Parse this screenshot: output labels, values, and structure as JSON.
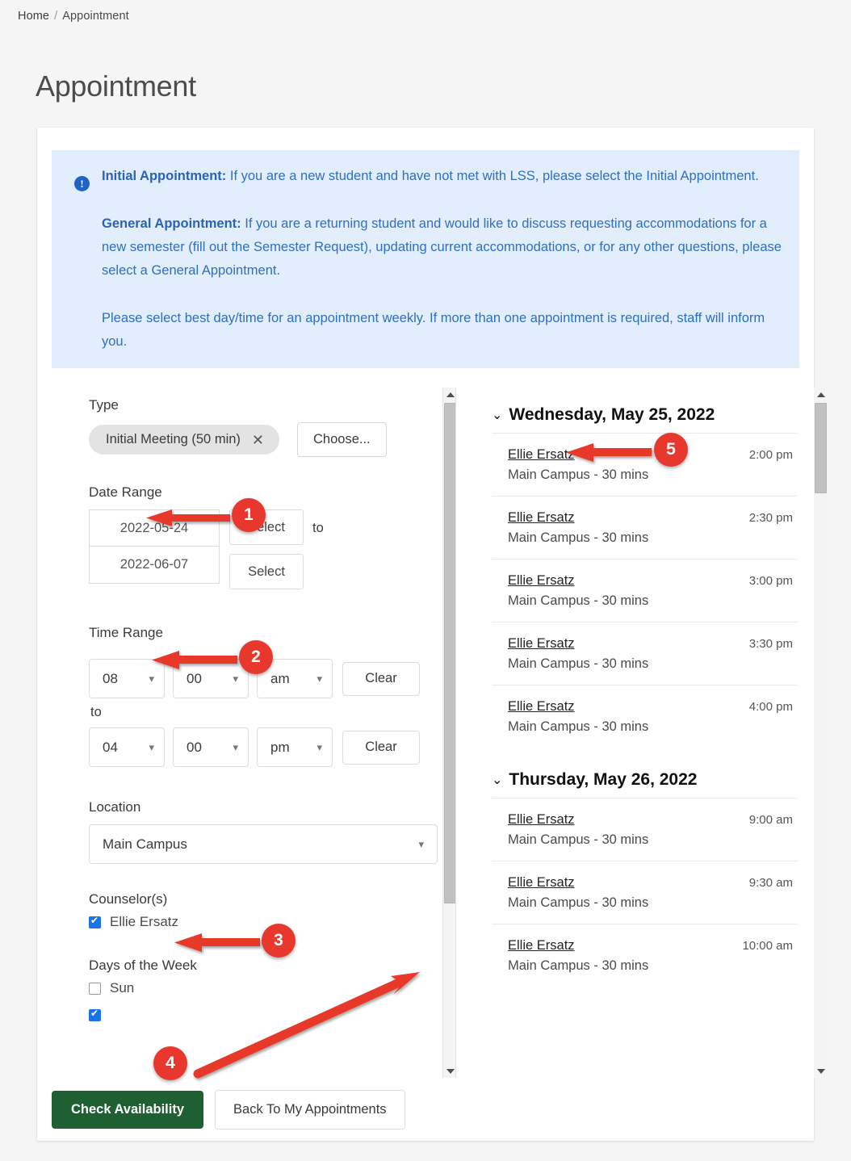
{
  "breadcrumb": {
    "home": "Home",
    "separator": "/",
    "current": "Appointment"
  },
  "page": {
    "title": "Appointment"
  },
  "info_banner": {
    "icon": "info-circle-icon",
    "exclam": "!",
    "p1_bold": "Initial Appointment:",
    "p1_text": " If you are a new student and have not met with LSS, please select the Initial Appointment.",
    "p2_bold": "General Appointment:",
    "p2_text": " If you are a returning student and would like to discuss requesting accommodations for a new semester (fill out the Semester Request), updating current accommodations, or for any other questions, please select a General Appointment.",
    "p3_text": "Please select best day/time for an appointment weekly. If more than one appointment is required, staff will inform you.",
    "bg_color": "#e3eefc",
    "text_color": "#2f6fc0"
  },
  "form": {
    "type": {
      "label": "Type",
      "chip_value": "Initial Meeting (50 min)",
      "chip_remove": "✕",
      "choose_label": "Choose..."
    },
    "date_range": {
      "label": "Date Range",
      "start_value": "2022-05-24",
      "end_value": "2022-06-07",
      "select_label_1": "Select",
      "select_label_2": "Select",
      "to_label": "to"
    },
    "time_range": {
      "label": "Time Range",
      "to_label": "to",
      "start": {
        "hour": "08",
        "minute": "00",
        "meridiem": "am",
        "clear_label": "Clear"
      },
      "end": {
        "hour": "04",
        "minute": "00",
        "meridiem": "pm",
        "clear_label": "Clear"
      }
    },
    "location": {
      "label": "Location",
      "value": "Main Campus"
    },
    "counselors": {
      "label": "Counselor(s)",
      "items": [
        {
          "name": "Ellie Ersatz",
          "checked": true
        }
      ]
    },
    "days_of_week": {
      "label": "Days of the Week",
      "items": [
        {
          "name": "Sun",
          "checked": false
        }
      ]
    }
  },
  "results": {
    "days": [
      {
        "header": "Wednesday, May 25, 2022",
        "chevron": "⌄",
        "slots": [
          {
            "name": "Ellie Ersatz",
            "meta": "Main Campus - 30 mins",
            "time": "2:00 pm"
          },
          {
            "name": "Ellie Ersatz",
            "meta": "Main Campus - 30 mins",
            "time": "2:30 pm"
          },
          {
            "name": "Ellie Ersatz",
            "meta": "Main Campus - 30 mins",
            "time": "3:00 pm"
          },
          {
            "name": "Ellie Ersatz",
            "meta": "Main Campus - 30 mins",
            "time": "3:30 pm"
          },
          {
            "name": "Ellie Ersatz",
            "meta": "Main Campus - 30 mins",
            "time": "4:00 pm"
          }
        ]
      },
      {
        "header": "Thursday, May 26, 2022",
        "chevron": "⌄",
        "slots": [
          {
            "name": "Ellie Ersatz",
            "meta": "Main Campus - 30 mins",
            "time": "9:00 am"
          },
          {
            "name": "Ellie Ersatz",
            "meta": "Main Campus - 30 mins",
            "time": "9:30 am"
          },
          {
            "name": "Ellie Ersatz",
            "meta": "Main Campus - 30 mins",
            "time": "10:00 am"
          }
        ]
      }
    ]
  },
  "footer": {
    "check_availability": "Check Availability",
    "back_to_appointments": "Back To My Appointments",
    "primary_color": "#1e6032"
  },
  "annotations": {
    "color": "#e8372c",
    "markers": [
      {
        "number": "1",
        "target": "Date Range"
      },
      {
        "number": "2",
        "target": "Time Range"
      },
      {
        "number": "3",
        "target": "Counselor(s)"
      },
      {
        "number": "4",
        "target": "left pane scrollbar"
      },
      {
        "number": "5",
        "target": "Ellie Ersatz slot link"
      }
    ]
  }
}
